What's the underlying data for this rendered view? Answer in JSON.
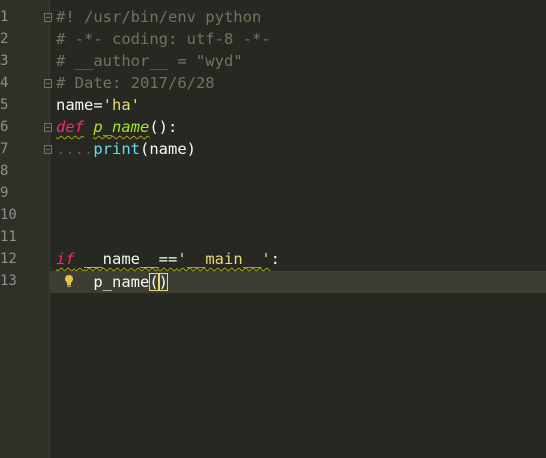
{
  "editor": {
    "line_numbers": [
      "1",
      "2",
      "3",
      "4",
      "5",
      "6",
      "7",
      "8",
      "9",
      "10",
      "11",
      "12",
      "13"
    ],
    "lines": {
      "l1": "#! /usr/bin/env python",
      "l2": "# -*- coding: utf-8 -*-",
      "l3": "# __author__ = \"wyd\"",
      "l4": "# Date: 2017/6/28",
      "l5_name": "name=",
      "l5_str": "'ha'",
      "l6_def": "def",
      "l6_fn": "p_name",
      "l6_rest": "():",
      "l7_indent": "....",
      "l7_print": "print",
      "l7_rest": "(name)",
      "l12_if": "if",
      "l12_name": "__name__",
      "l12_eq": "==",
      "l12_str": "'__main__'",
      "l12_colon": ":",
      "l13_call": "p_name",
      "l13_open": "(",
      "l13_close": ")"
    },
    "colors": {
      "background": "#272822",
      "gutter": "#2f3129",
      "comment": "#75715e",
      "string": "#e6db74",
      "keyword": "#f92672",
      "builtin": "#66d9ef",
      "function": "#a6e22e",
      "text": "#f8f8f2"
    },
    "icons": {
      "intention": "lightbulb-icon",
      "fold": "fold-marker-icon"
    },
    "current_line": "13"
  }
}
